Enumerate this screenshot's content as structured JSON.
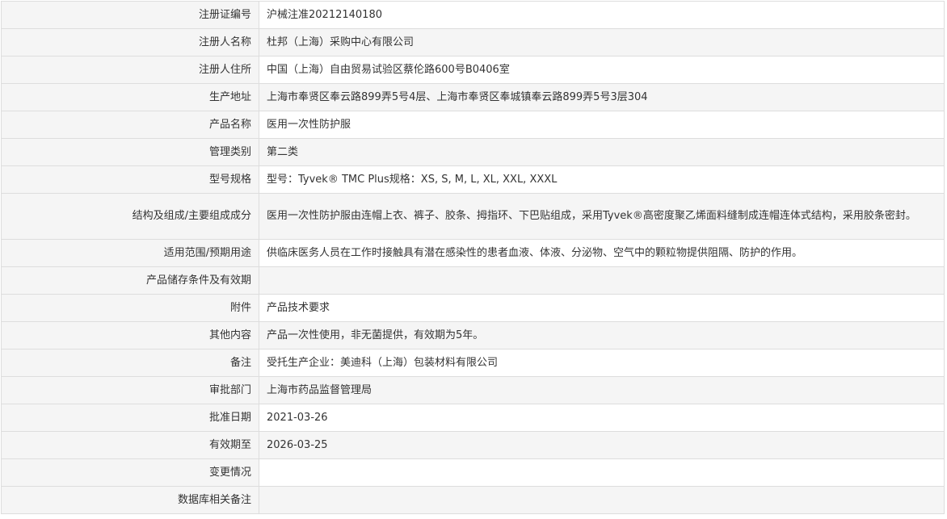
{
  "rows": [
    {
      "label": "注册证编号",
      "value": "沪械注准20212140180"
    },
    {
      "label": "注册人名称",
      "value": "杜邦（上海）采购中心有限公司"
    },
    {
      "label": "注册人住所",
      "value": "中国（上海）自由贸易试验区蔡伦路600号B0406室"
    },
    {
      "label": "生产地址",
      "value": "上海市奉贤区奉云路899弄5号4层、上海市奉贤区奉城镇奉云路899弄5号3层304"
    },
    {
      "label": "产品名称",
      "value": "医用一次性防护服"
    },
    {
      "label": "管理类别",
      "value": "第二类"
    },
    {
      "label": "型号规格",
      "value": "型号：Tyvek® TMC Plus规格：XS, S, M, L, XL, XXL, XXXL"
    },
    {
      "label": "结构及组成/主要组成成分",
      "value": "医用一次性防护服由连帽上衣、裤子、胶条、拇指环、下巴贴组成，采用Tyvek®高密度聚乙烯面料缝制成连帽连体式结构，采用胶条密封。"
    },
    {
      "label": "适用范围/预期用途",
      "value": "供临床医务人员在工作时接触具有潜在感染性的患者血液、体液、分泌物、空气中的颗粒物提供阻隔、防护的作用。"
    },
    {
      "label": "产品储存条件及有效期",
      "value": ""
    },
    {
      "label": "附件",
      "value": "产品技术要求"
    },
    {
      "label": "其他内容",
      "value": "产品一次性使用，非无菌提供，有效期为5年。"
    },
    {
      "label": "备注",
      "value": "受托生产企业：美迪科（上海）包装材料有限公司"
    },
    {
      "label": "审批部门",
      "value": "上海市药品监督管理局"
    },
    {
      "label": "批准日期",
      "value": "2021-03-26"
    },
    {
      "label": "有效期至",
      "value": "2026-03-25"
    },
    {
      "label": "变更情况",
      "value": ""
    },
    {
      "label": "数据库相关备注",
      "value": ""
    }
  ]
}
